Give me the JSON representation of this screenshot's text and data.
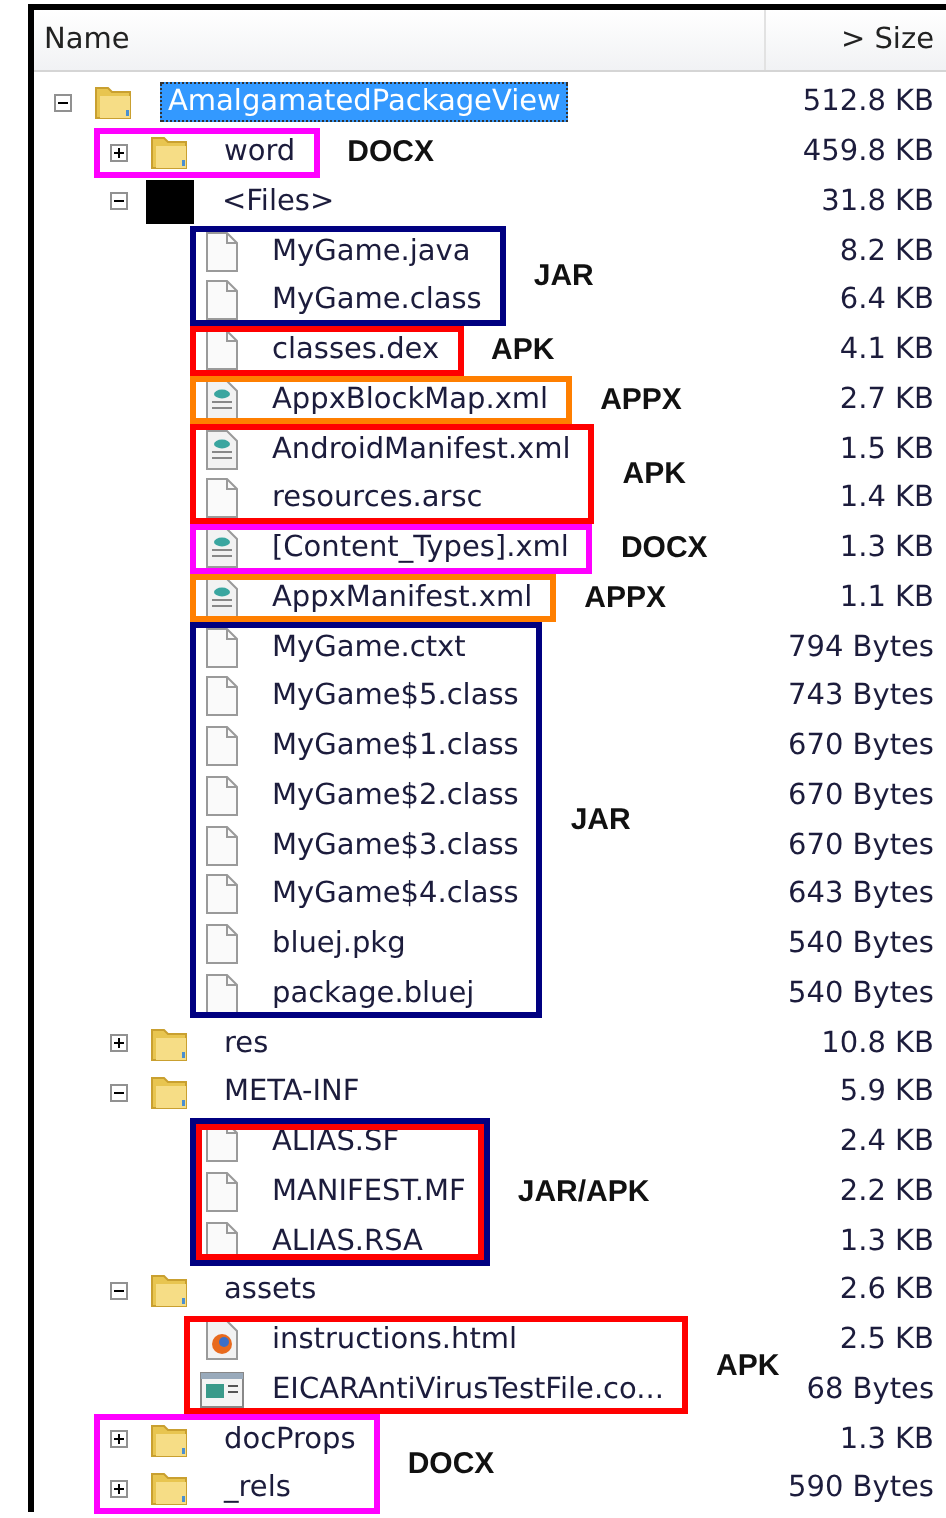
{
  "columns": [
    {
      "label": "Name"
    },
    {
      "label": "> Size"
    }
  ],
  "tree": {
    "name": "AmalgamatedPackageView",
    "size": "512.8 KB",
    "kind": "folder",
    "expanded": true,
    "selected": true,
    "children": [
      {
        "kind": "group",
        "label": "DOCX",
        "color": "#ff00ff",
        "items": [
          {
            "name": "word",
            "size": "459.8 KB",
            "kind": "folder",
            "expanded": false,
            "selected": false
          }
        ]
      },
      {
        "name": "<Files>",
        "size": "31.8 KB",
        "kind": "block",
        "expanded": true,
        "selected": false,
        "children": [
          {
            "kind": "group",
            "label": "JAR",
            "color": "#000080",
            "items": [
              {
                "name": "MyGame.java",
                "size": "8.2 KB",
                "kind": "file",
                "selected": false
              },
              {
                "name": "MyGame.class",
                "size": "6.4 KB",
                "kind": "file",
                "selected": false
              }
            ]
          },
          {
            "kind": "group",
            "label": "APK",
            "color": "#ff0000",
            "items": [
              {
                "name": "classes.dex",
                "size": "4.1 KB",
                "kind": "file",
                "selected": false
              }
            ]
          },
          {
            "kind": "group",
            "label": "APPX",
            "color": "#ff7f00",
            "items": [
              {
                "name": "AppxBlockMap.xml",
                "size": "2.7 KB",
                "kind": "xml",
                "selected": false
              }
            ]
          },
          {
            "kind": "group",
            "label": "APK",
            "color": "#ff0000",
            "items": [
              {
                "name": "AndroidManifest.xml",
                "size": "1.5 KB",
                "kind": "xml",
                "selected": false
              },
              {
                "name": "resources.arsc",
                "size": "1.4 KB",
                "kind": "file",
                "selected": false
              }
            ]
          },
          {
            "kind": "group",
            "label": "DOCX",
            "color": "#ff00ff",
            "items": [
              {
                "name": "[Content_Types].xml",
                "size": "1.3 KB",
                "kind": "xml",
                "selected": false
              }
            ]
          },
          {
            "kind": "group",
            "label": "APPX",
            "color": "#ff7f00",
            "items": [
              {
                "name": "AppxManifest.xml",
                "size": "1.1 KB",
                "kind": "xml",
                "selected": false
              }
            ]
          },
          {
            "kind": "group",
            "label": "JAR",
            "color": "#000080",
            "items": [
              {
                "name": "MyGame.ctxt",
                "size": "794 Bytes",
                "kind": "file",
                "selected": false
              },
              {
                "name": "MyGame$5.class",
                "size": "743 Bytes",
                "kind": "file",
                "selected": false
              },
              {
                "name": "MyGame$1.class",
                "size": "670 Bytes",
                "kind": "file",
                "selected": false
              },
              {
                "name": "MyGame$2.class",
                "size": "670 Bytes",
                "kind": "file",
                "selected": false
              },
              {
                "name": "MyGame$3.class",
                "size": "670 Bytes",
                "kind": "file",
                "selected": false
              },
              {
                "name": "MyGame$4.class",
                "size": "643 Bytes",
                "kind": "file",
                "selected": false
              },
              {
                "name": "bluej.pkg",
                "size": "540 Bytes",
                "kind": "file",
                "selected": false
              },
              {
                "name": "package.bluej",
                "size": "540 Bytes",
                "kind": "file",
                "selected": false
              }
            ]
          }
        ]
      },
      {
        "name": "res",
        "size": "10.8 KB",
        "kind": "folder",
        "expanded": false,
        "selected": false
      },
      {
        "name": "META-INF",
        "size": "5.9 KB",
        "kind": "folder",
        "expanded": true,
        "selected": false,
        "children": [
          {
            "kind": "group",
            "label": "JAR/APK",
            "color": "#000080",
            "items": [
              {
                "kind": "group",
                "color": "#ff0000",
                "items": [
                  {
                    "name": "ALIAS.SF",
                    "size": "2.4 KB",
                    "kind": "file",
                    "selected": false
                  },
                  {
                    "name": "MANIFEST.MF",
                    "size": "2.2 KB",
                    "kind": "file",
                    "selected": false
                  },
                  {
                    "name": "ALIAS.RSA",
                    "size": "1.3 KB",
                    "kind": "file",
                    "selected": false
                  }
                ]
              }
            ]
          }
        ]
      },
      {
        "name": "assets",
        "size": "2.6 KB",
        "kind": "folder",
        "expanded": true,
        "selected": false,
        "children": [
          {
            "kind": "group",
            "label": "APK",
            "color": "#ff0000",
            "items": [
              {
                "name": "instructions.html",
                "size": "2.5 KB",
                "kind": "html",
                "selected": false
              },
              {
                "name": "EICARAntiVirusTestFile.co...",
                "size": "68 Bytes",
                "kind": "app",
                "selected": false
              }
            ]
          }
        ]
      },
      {
        "kind": "group",
        "label": "DOCX",
        "color": "#ff00ff",
        "items": [
          {
            "name": "docProps",
            "size": "1.3 KB",
            "kind": "folder",
            "expanded": false,
            "selected": false
          },
          {
            "name": "_rels",
            "size": "590 Bytes",
            "kind": "folder",
            "expanded": false,
            "selected": false
          }
        ]
      }
    ]
  }
}
